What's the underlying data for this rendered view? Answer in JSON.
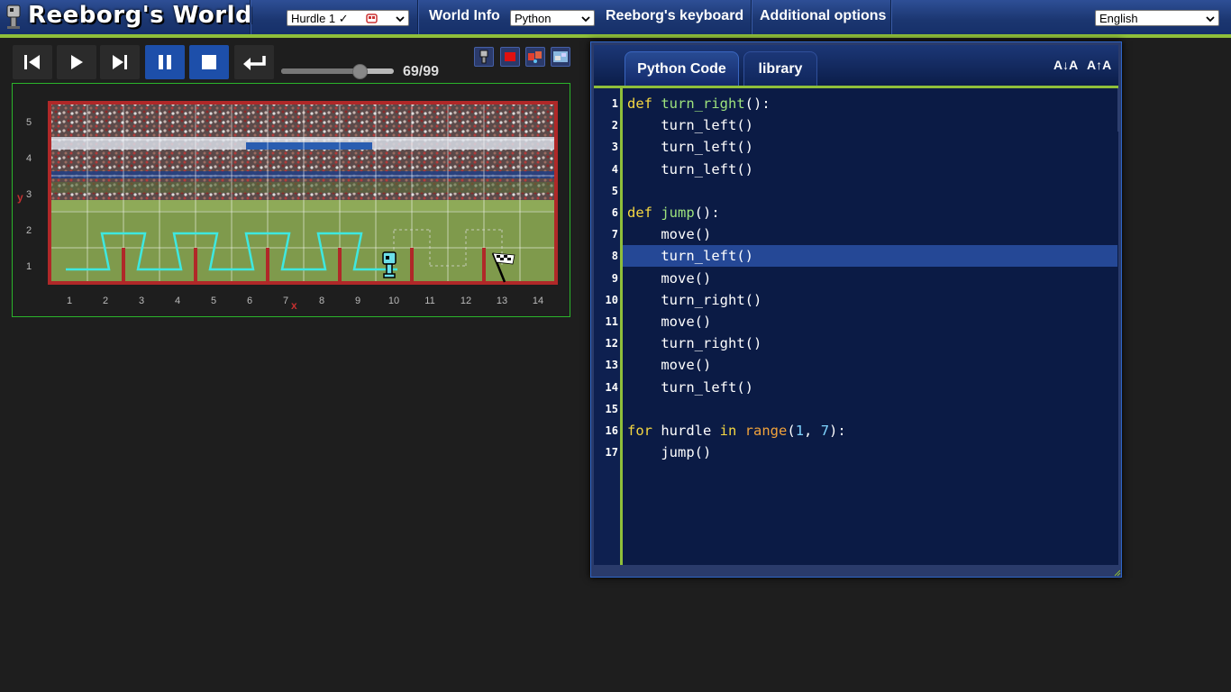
{
  "app": {
    "title": "Reeborg's World"
  },
  "topbar": {
    "world_select": "Hurdle 1 ✓",
    "world_info": "World Info",
    "language_mode": "Python",
    "keyboard": "Reeborg's keyboard",
    "additional_options": "Additional options",
    "ui_language": "English"
  },
  "controls": {
    "step_current": 69,
    "step_total": 99,
    "step_label": "69/99"
  },
  "world": {
    "y_label": "y",
    "x_label": "x",
    "y_ticks": [
      "1",
      "2",
      "3",
      "4",
      "5"
    ],
    "x_ticks": [
      "1",
      "2",
      "3",
      "4",
      "5",
      "6",
      "7",
      "8",
      "9",
      "10",
      "11",
      "12",
      "13",
      "14"
    ],
    "robot": {
      "x": 10,
      "y": 1,
      "facing": "north"
    },
    "goal": {
      "x": 13,
      "y": 1
    },
    "walls_after_x": [
      2,
      4,
      6,
      8,
      10,
      12
    ]
  },
  "editor": {
    "tab_python": "Python Code",
    "tab_library": "library",
    "font_decrease": "A↓A",
    "font_increase": "A↑A",
    "highlighted_line": 8,
    "line_numbers": [
      "1",
      "2",
      "3",
      "4",
      "5",
      "6",
      "7",
      "8",
      "9",
      "10",
      "11",
      "12",
      "13",
      "14",
      "15",
      "16",
      "17"
    ],
    "lines": [
      "def turn_right():",
      "    turn_left()",
      "    turn_left()",
      "    turn_left()",
      "",
      "def jump():",
      "    move()",
      "    turn_left()",
      "    move()",
      "    turn_right()",
      "    move()",
      "    turn_right()",
      "    move()",
      "    turn_left()",
      "",
      "for hurdle in range(1, 7):",
      "    jump()"
    ]
  },
  "colors": {
    "topbar": "#1b3670",
    "accent_green": "#8fbf3a",
    "active_button": "#1d4faa",
    "trace": "#3ee8e0",
    "wall": "#b02828"
  }
}
